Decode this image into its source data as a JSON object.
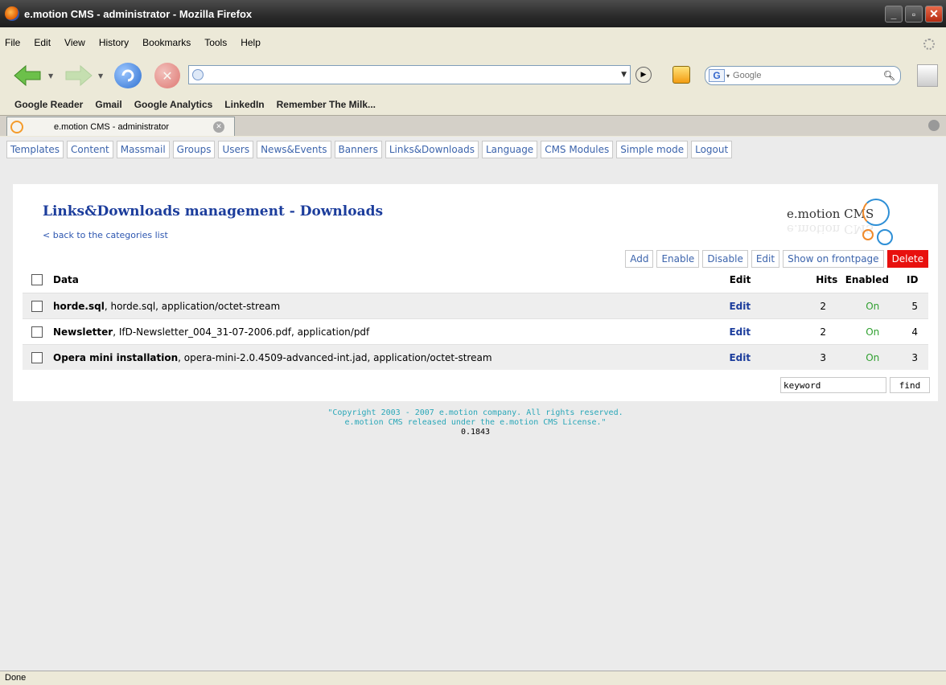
{
  "window": {
    "title": "e.motion CMS - administrator - Mozilla Firefox"
  },
  "menu": [
    "File",
    "Edit",
    "View",
    "History",
    "Bookmarks",
    "Tools",
    "Help"
  ],
  "toolbar": {
    "url_value": "",
    "search_placeholder": "Google"
  },
  "bookmarks": [
    "Google Reader",
    "Gmail",
    "Google Analytics",
    "LinkedIn",
    "Remember The Milk..."
  ],
  "tab": {
    "label": "e.motion CMS - administrator"
  },
  "cms_nav": [
    "Templates",
    "Content",
    "Massmail",
    "Groups",
    "Users",
    "News&Events",
    "Banners",
    "Links&Downloads",
    "Language",
    "CMS Modules",
    "Simple mode",
    "Logout"
  ],
  "page": {
    "title": "Links&Downloads management - Downloads",
    "back_link": "< back to the categories list",
    "logo_text": "e.motion CMS"
  },
  "actions": [
    "Add",
    "Enable",
    "Disable",
    "Edit",
    "Show on frontpage",
    "Delete"
  ],
  "table": {
    "headers": {
      "data": "Data",
      "edit": "Edit",
      "hits": "Hits",
      "enabled": "Enabled",
      "id": "ID"
    },
    "rows": [
      {
        "name": "horde.sql",
        "rest": ", horde.sql, application/octet-stream",
        "edit": "Edit",
        "hits": "2",
        "enabled": "On",
        "id": "5"
      },
      {
        "name": "Newsletter",
        "rest": ", IfD-Newsletter_004_31-07-2006.pdf, application/pdf",
        "edit": "Edit",
        "hits": "2",
        "enabled": "On",
        "id": "4"
      },
      {
        "name": "Opera mini installation",
        "rest": ", opera-mini-2.0.4509-advanced-int.jad, application/octet-stream",
        "edit": "Edit",
        "hits": "3",
        "enabled": "On",
        "id": "3"
      }
    ]
  },
  "search": {
    "value": "keyword",
    "button": "find"
  },
  "footer": {
    "line1": "\"Copyright 2003 - 2007 e.motion company. All rights reserved.",
    "line2": "e.motion CMS released under the e.motion CMS License.\"",
    "version": "0.1843"
  },
  "status": "Done"
}
